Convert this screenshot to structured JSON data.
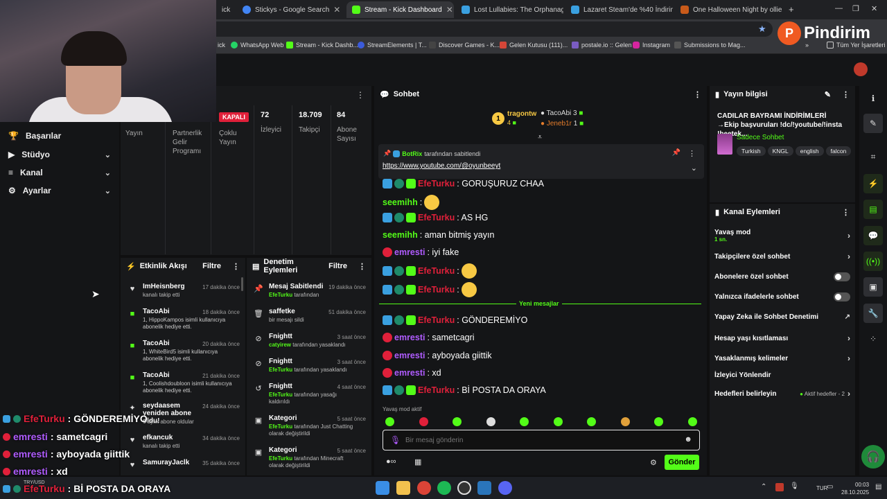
{
  "browser": {
    "tabs": [
      {
        "label": "Stickys - Google Search",
        "color": "#4285f4"
      },
      {
        "label": "Stream - Kick Dashboard",
        "color": "#53fc18",
        "active": true
      },
      {
        "label": "Lost Lullabies: The Orphanage",
        "color": "#3aa0e0"
      },
      {
        "label": "Lazaret Steam'de %40 İndirimli",
        "color": "#3aa0e0"
      },
      {
        "label": "One Halloween Night by ollie",
        "color": "#c85a1a"
      }
    ],
    "bookmarks": [
      "WhatsApp Web",
      "Stream - Kick Dashb...",
      "StreamElements | T...",
      "Discover Games - K...",
      "Gelen Kutusu (111)...",
      "postale.io :: Gelen",
      "Instagram",
      "Submissions to Mag..."
    ],
    "all_bookmarks": "Tüm Yer İşaretleri",
    "tab_fragment": "ick",
    "watermark": "Pindirim"
  },
  "sidebar": {
    "items": [
      "Başarılar",
      "Stüdyo",
      "Kanal",
      "Ayarlar"
    ]
  },
  "stats": {
    "offline_badge": "KAPALI",
    "cols": [
      {
        "value": "",
        "label": "Yayın"
      },
      {
        "value": "",
        "label": "Partnerlik Gelir Programı"
      },
      {
        "value": "",
        "label": "Çoklu Yayın"
      },
      {
        "value": "72",
        "label": "İzleyici"
      },
      {
        "value": "18.709",
        "label": "Takipçi"
      },
      {
        "value": "84",
        "label": "Abone Sayısı"
      }
    ]
  },
  "feed": {
    "title": "Etkinlik Akışı",
    "filter": "Filtre",
    "items": [
      {
        "name": "ImHeisnberg",
        "time": "17 dakika önce",
        "desc": "kanalı takip etti",
        "icon": "♥"
      },
      {
        "name": "TacoAbi",
        "time": "18 dakika önce",
        "desc": "1, HippoKampos isimli kullanıcıya abonelik hediye etti.",
        "icon": "■"
      },
      {
        "name": "TacoAbi",
        "time": "20 dakika önce",
        "desc": "1, WhiteBird5 isimli kullanıcıya abonelik hediye etti.",
        "icon": "■"
      },
      {
        "name": "TacoAbi",
        "time": "21 dakika önce",
        "desc": "1, Coolishdoubloon isimli kullanıcıya abonelik hediye etti.",
        "icon": "■"
      },
      {
        "name": "seydaasem yeniden abone oldu!",
        "time": "24 dakika önce",
        "desc": "6 aylık abone oldular",
        "icon": "✦"
      },
      {
        "name": "efkancuk",
        "time": "34 dakika önce",
        "desc": "kanalı takip etti",
        "icon": "♥"
      },
      {
        "name": "SamurayJaclk",
        "time": "35 dakika önce",
        "desc": "",
        "icon": "♥"
      }
    ]
  },
  "mod": {
    "title": "Denetim Eylemleri",
    "filter": "Filtre",
    "items": [
      {
        "name": "Mesaj Sabitlendi",
        "time": "19 dakika önce",
        "user": "EfeTurku",
        "desc": "tarafından",
        "icon": "📌"
      },
      {
        "name": "saffetke",
        "time": "51 dakika önce",
        "user": "",
        "desc": "bir mesajı sildi",
        "icon": "🗑"
      },
      {
        "name": "Fnightt",
        "time": "3 saat önce",
        "user": "catyirew",
        "desc": "tarafından yasaklandı",
        "icon": "⊘"
      },
      {
        "name": "Fnightt",
        "time": "3 saat önce",
        "user": "EfeTurku",
        "desc": "tarafından yasaklandı",
        "icon": "⊘"
      },
      {
        "name": "Fnightt",
        "time": "4 saat önce",
        "user": "EfeTurku",
        "desc": "tarafından yasağı kaldırıldı",
        "icon": "↺"
      },
      {
        "name": "Kategori",
        "time": "5 saat önce",
        "user": "EfeTurku",
        "desc": "tarafından Just Chatting olarak değiştirildi",
        "icon": "▣"
      },
      {
        "name": "Kategori",
        "time": "5 saat önce",
        "user": "EfeTurku",
        "desc": "tarafından Minecraft olarak değiştirildi",
        "icon": "▣"
      }
    ]
  },
  "chat": {
    "title": "Sohbet",
    "leaders": {
      "rank": "1",
      "first": "tragontw",
      "first_count": "4",
      "second": "TacoAbi",
      "second_count": "3",
      "third": "Jeneb1r",
      "third_count": "1"
    },
    "pinned_by": "BotRix",
    "pinned_suffix": "tarafından sabitlendi",
    "pinned_link": "https://www.youtube.com/@oyunbeeyt",
    "messages": [
      {
        "user": "EfeTurku",
        "color": "red",
        "text": ": GORUŞURUZ CHAA",
        "badges": 3
      },
      {
        "user": "seemihh",
        "color": "grn",
        "text": ":",
        "emoji": true,
        "badges": 0
      },
      {
        "user": "EfeTurku",
        "color": "red",
        "text": ": AS HG",
        "badges": 3
      },
      {
        "user": "seemihh",
        "color": "grn",
        "text": ": aman bitmiş yayın",
        "badges": 0
      },
      {
        "user": "emresti",
        "color": "pur",
        "text": ": iyi fake",
        "badges": 1
      },
      {
        "user": "EfeTurku",
        "color": "red",
        "text": ":",
        "emoji": true,
        "badges": 3
      },
      {
        "user": "EfeTurku",
        "color": "red",
        "text": ":",
        "emoji": true,
        "badges": 3
      }
    ],
    "new_divider": "Yeni mesajlar",
    "new_messages": [
      {
        "user": "EfeTurku",
        "color": "red",
        "text": ": GÖNDEREMİYO",
        "badges": 3
      },
      {
        "user": "emresti",
        "color": "pur",
        "text": ": sametcagri",
        "badges": 1
      },
      {
        "user": "emresti",
        "color": "pur",
        "text": ": ayboyada giittik",
        "badges": 1
      },
      {
        "user": "emresti",
        "color": "pur",
        "text": ": xd",
        "badges": 1
      },
      {
        "user": "EfeTurku",
        "color": "red",
        "text": ": Bİ POSTA DA ORAYA",
        "badges": 3
      }
    ],
    "slow_mode": "Yavaş mod aktif",
    "placeholder": "Bir mesaj gönderin",
    "send": "Gönder"
  },
  "info": {
    "title": "Yayın bilgisi",
    "stream_title": "CADILAR BAYRAMI İNDİRİMLERİ →Ekip başvuruları !dc/!youtube/!insta !beetek...",
    "category": "Sadece Sohbet",
    "tags": [
      "Turkish",
      "KNGL",
      "english",
      "falcon"
    ]
  },
  "actions": {
    "title": "Kanal Eylemleri",
    "items": [
      {
        "label": "Yavaş mod",
        "sub": "1 sn.",
        "control": "arrow"
      },
      {
        "label": "Takipçilere özel sohbet",
        "control": "arrow"
      },
      {
        "label": "Abonelere özel sohbet",
        "control": "toggle"
      },
      {
        "label": "Yalnızca ifadelerle sohbet",
        "control": "toggle"
      },
      {
        "label": "Yapay Zeka ile Sohbet Denetimi",
        "control": "ext"
      },
      {
        "label": "Hesap yaşı kısıtlaması",
        "control": "arrow"
      },
      {
        "label": "Yasaklanmış kelimeler",
        "control": "arrow"
      },
      {
        "label": "İzleyici Yönlendir",
        "control": "none"
      },
      {
        "label": "Hedefleri belirleyin",
        "control": "goals",
        "extra": "Aktif hedefler - 2"
      }
    ]
  },
  "overlay": [
    {
      "user": "EfeTurku",
      "text": ": GÖNDEREMİYO",
      "color": "#e0203a"
    },
    {
      "user": "emresti",
      "text": ": sametcagri",
      "color": "#b05cff"
    },
    {
      "user": "emresti",
      "text": ": ayboyada giittik",
      "color": "#b05cff"
    },
    {
      "user": "emresti",
      "text": ": xd",
      "color": "#b05cff"
    },
    {
      "user": "EfeTurku",
      "text": ": Bİ POSTA DA ORAYA",
      "color": "#e0203a"
    }
  ],
  "taskbar": {
    "lang": "TUR",
    "time": "00:03",
    "date": "28.10.2025",
    "ticker": "TRY/USD"
  }
}
